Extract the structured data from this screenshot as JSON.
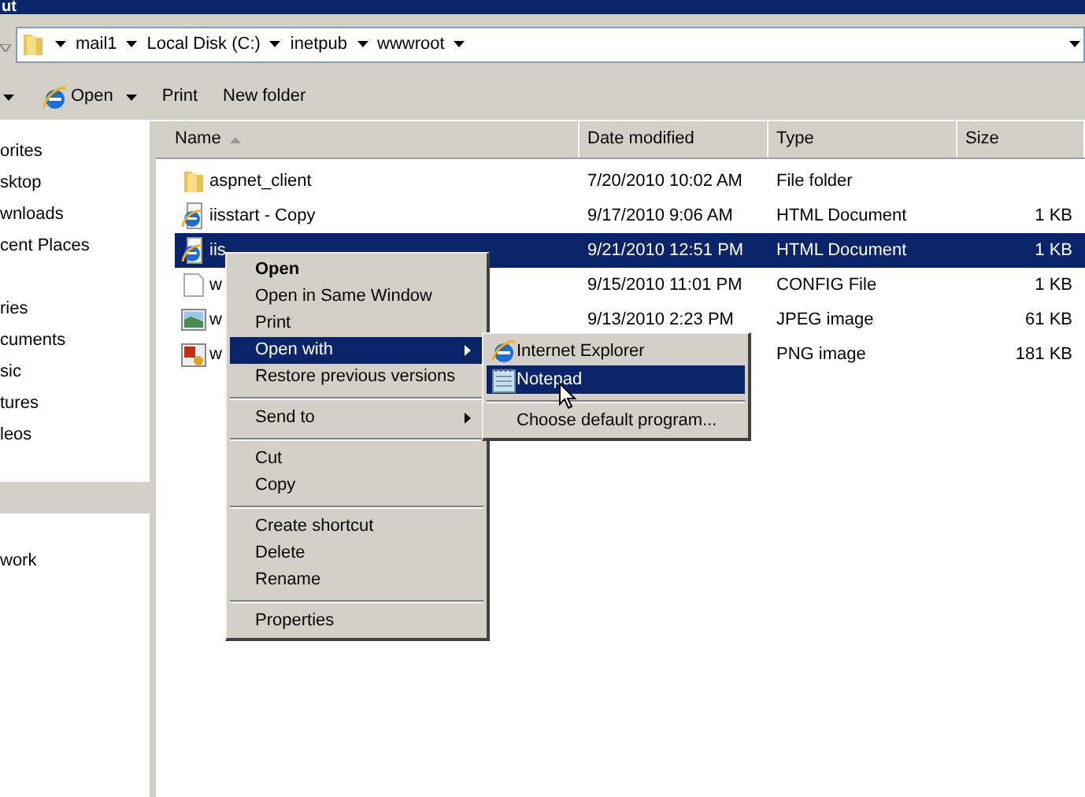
{
  "title_bar": {
    "title": "ut"
  },
  "address_bar": {
    "crumbs": [
      "mail1",
      "Local Disk (C:)",
      "inetpub",
      "wwwroot"
    ]
  },
  "toolbar": {
    "items": [
      {
        "label": "Open",
        "kind": "menu"
      },
      {
        "label": "Print",
        "kind": "plain"
      },
      {
        "label": "New folder",
        "kind": "plain"
      }
    ]
  },
  "nav_pane": {
    "groups": [
      [
        {
          "label": "orites",
          "selected": false
        },
        {
          "label": "sktop",
          "selected": false
        },
        {
          "label": "wnloads",
          "selected": false
        },
        {
          "label": "cent Places",
          "selected": false
        }
      ],
      [
        {
          "label": "ries",
          "selected": false
        },
        {
          "label": "cuments",
          "selected": false
        },
        {
          "label": "sic",
          "selected": false
        },
        {
          "label": "tures",
          "selected": false
        },
        {
          "label": "leos",
          "selected": false
        }
      ],
      [
        {
          "selected": true
        }
      ],
      [
        {
          "label": "work",
          "selected": false
        }
      ]
    ]
  },
  "table": {
    "columns": [
      {
        "label": "Name",
        "sorted": true
      },
      {
        "label": "Date modified",
        "sorted": false
      },
      {
        "label": "Type",
        "sorted": false
      },
      {
        "label": "Size",
        "sorted": false
      }
    ],
    "rows": [
      {
        "kind": "folder",
        "name": "aspnet_client",
        "date": "7/20/2010 10:02 AM",
        "type": "File folder",
        "selected": false
      },
      {
        "kind": "html",
        "name": "iisstart - Copy",
        "date": "9/17/2010 9:06 AM",
        "type": "HTML Document",
        "size": "1 KB",
        "selected": false
      },
      {
        "kind": "html",
        "name": "iis",
        "date": "9/21/2010 12:51 PM",
        "type": "HTML Document",
        "size": "1 KB",
        "selected": true
      },
      {
        "kind": "config",
        "name": "w",
        "date": "9/15/2010 11:01 PM",
        "type": "CONFIG File",
        "size": "1 KB",
        "selected": false
      },
      {
        "kind": "jpeg",
        "name": "w",
        "date": "9/13/2010 2:23 PM",
        "type": "JPEG image",
        "size": "61 KB",
        "selected": false
      },
      {
        "kind": "png",
        "name": "w",
        "type": "PNG image",
        "size": "181 KB",
        "selected": false
      }
    ]
  },
  "context_menu": {
    "items": [
      {
        "kind": "item",
        "label": "Open",
        "default": true,
        "submenu": false,
        "selected": false
      },
      {
        "kind": "item",
        "label": "Open in Same Window",
        "default": false,
        "submenu": false,
        "selected": false
      },
      {
        "kind": "item",
        "label": "Print",
        "default": false,
        "submenu": false,
        "selected": false
      },
      {
        "kind": "item",
        "label": "Open with",
        "default": false,
        "submenu": true,
        "selected": true
      },
      {
        "kind": "item",
        "label": "Restore previous versions",
        "default": false,
        "submenu": false,
        "selected": false
      },
      {
        "kind": "separator"
      },
      {
        "kind": "item",
        "label": "Send to",
        "default": false,
        "submenu": true,
        "selected": false
      },
      {
        "kind": "separator"
      },
      {
        "kind": "item",
        "label": "Cut",
        "default": false,
        "submenu": false,
        "selected": false
      },
      {
        "kind": "item",
        "label": "Copy",
        "default": false,
        "submenu": false,
        "selected": false
      },
      {
        "kind": "separator"
      },
      {
        "kind": "item",
        "label": "Create shortcut",
        "default": false,
        "submenu": false,
        "selected": false
      },
      {
        "kind": "item",
        "label": "Delete",
        "default": false,
        "submenu": false,
        "selected": false
      },
      {
        "kind": "item",
        "label": "Rename",
        "default": false,
        "submenu": false,
        "selected": false
      },
      {
        "kind": "separator"
      },
      {
        "kind": "item",
        "label": "Properties",
        "default": false,
        "submenu": false,
        "selected": false
      }
    ]
  },
  "open_with_menu": {
    "items": [
      {
        "kind": "browser_app",
        "label": "Internet Explorer",
        "selected": false
      },
      {
        "kind": "notepad_app",
        "label": "Notepad",
        "selected": true
      },
      {
        "kind": "separator"
      },
      {
        "kind": "item",
        "label": "Choose default program...",
        "selected": false
      }
    ]
  }
}
